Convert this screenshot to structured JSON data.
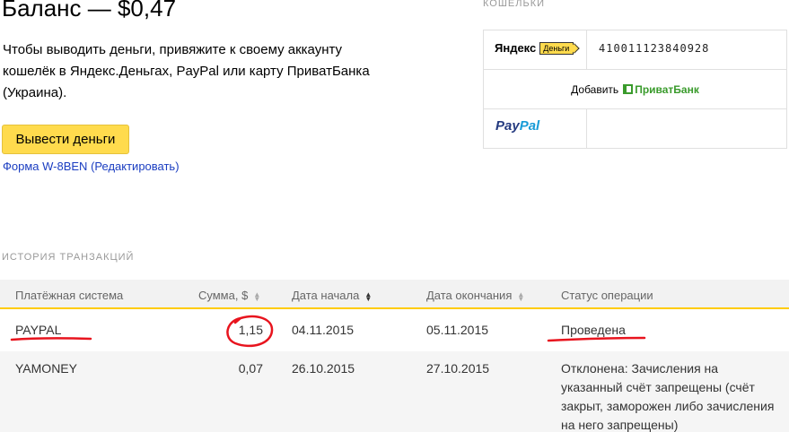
{
  "balance": {
    "title": "Баланс — $0,47"
  },
  "info": {
    "text": "Чтобы выводить деньги, привяжите к своему аккаунту кошелёк в Яндекс.Деньгах, PayPal или карту ПриватБанка (Украина).",
    "withdraw_button": "Вывести деньги",
    "w8_form": "Форма W-8BEN",
    "w8_edit": "(Редактировать)"
  },
  "wallets": {
    "heading": "КОШЕЛЬКИ",
    "yandex": {
      "logo_name": "Яндекс",
      "logo_badge": "Деньги",
      "number": "410011123840928"
    },
    "privat": {
      "add_label": "Добавить",
      "logo_text": "ПриватБанк"
    },
    "paypal": {
      "logo_pay": "Pay",
      "logo_pal": "Pal"
    }
  },
  "history": {
    "heading": "ИСТОРИЯ ТРАНЗАКЦИЙ",
    "columns": {
      "system": "Платёжная система",
      "amount": "Сумма, $",
      "start": "Дата начала",
      "end": "Дата окончания",
      "status": "Статус операции"
    },
    "rows": [
      {
        "system": "PAYPAL",
        "amount": "1,15",
        "start": "04.11.2015",
        "end": "05.11.2015",
        "status": "Проведена"
      },
      {
        "system": "YAMONEY",
        "amount": "0,07",
        "start": "26.10.2015",
        "end": "27.10.2015",
        "status": "Отклонена: Зачисления на указанный счёт запрещены (счёт закрыт, заморожен либо зачисления на него запрещены)"
      }
    ]
  },
  "colors": {
    "accent_yellow": "#ffdb4d",
    "link_blue": "#1a3dc1",
    "annotation_red": "#e8141e",
    "privat_green": "#3a9b2c"
  }
}
